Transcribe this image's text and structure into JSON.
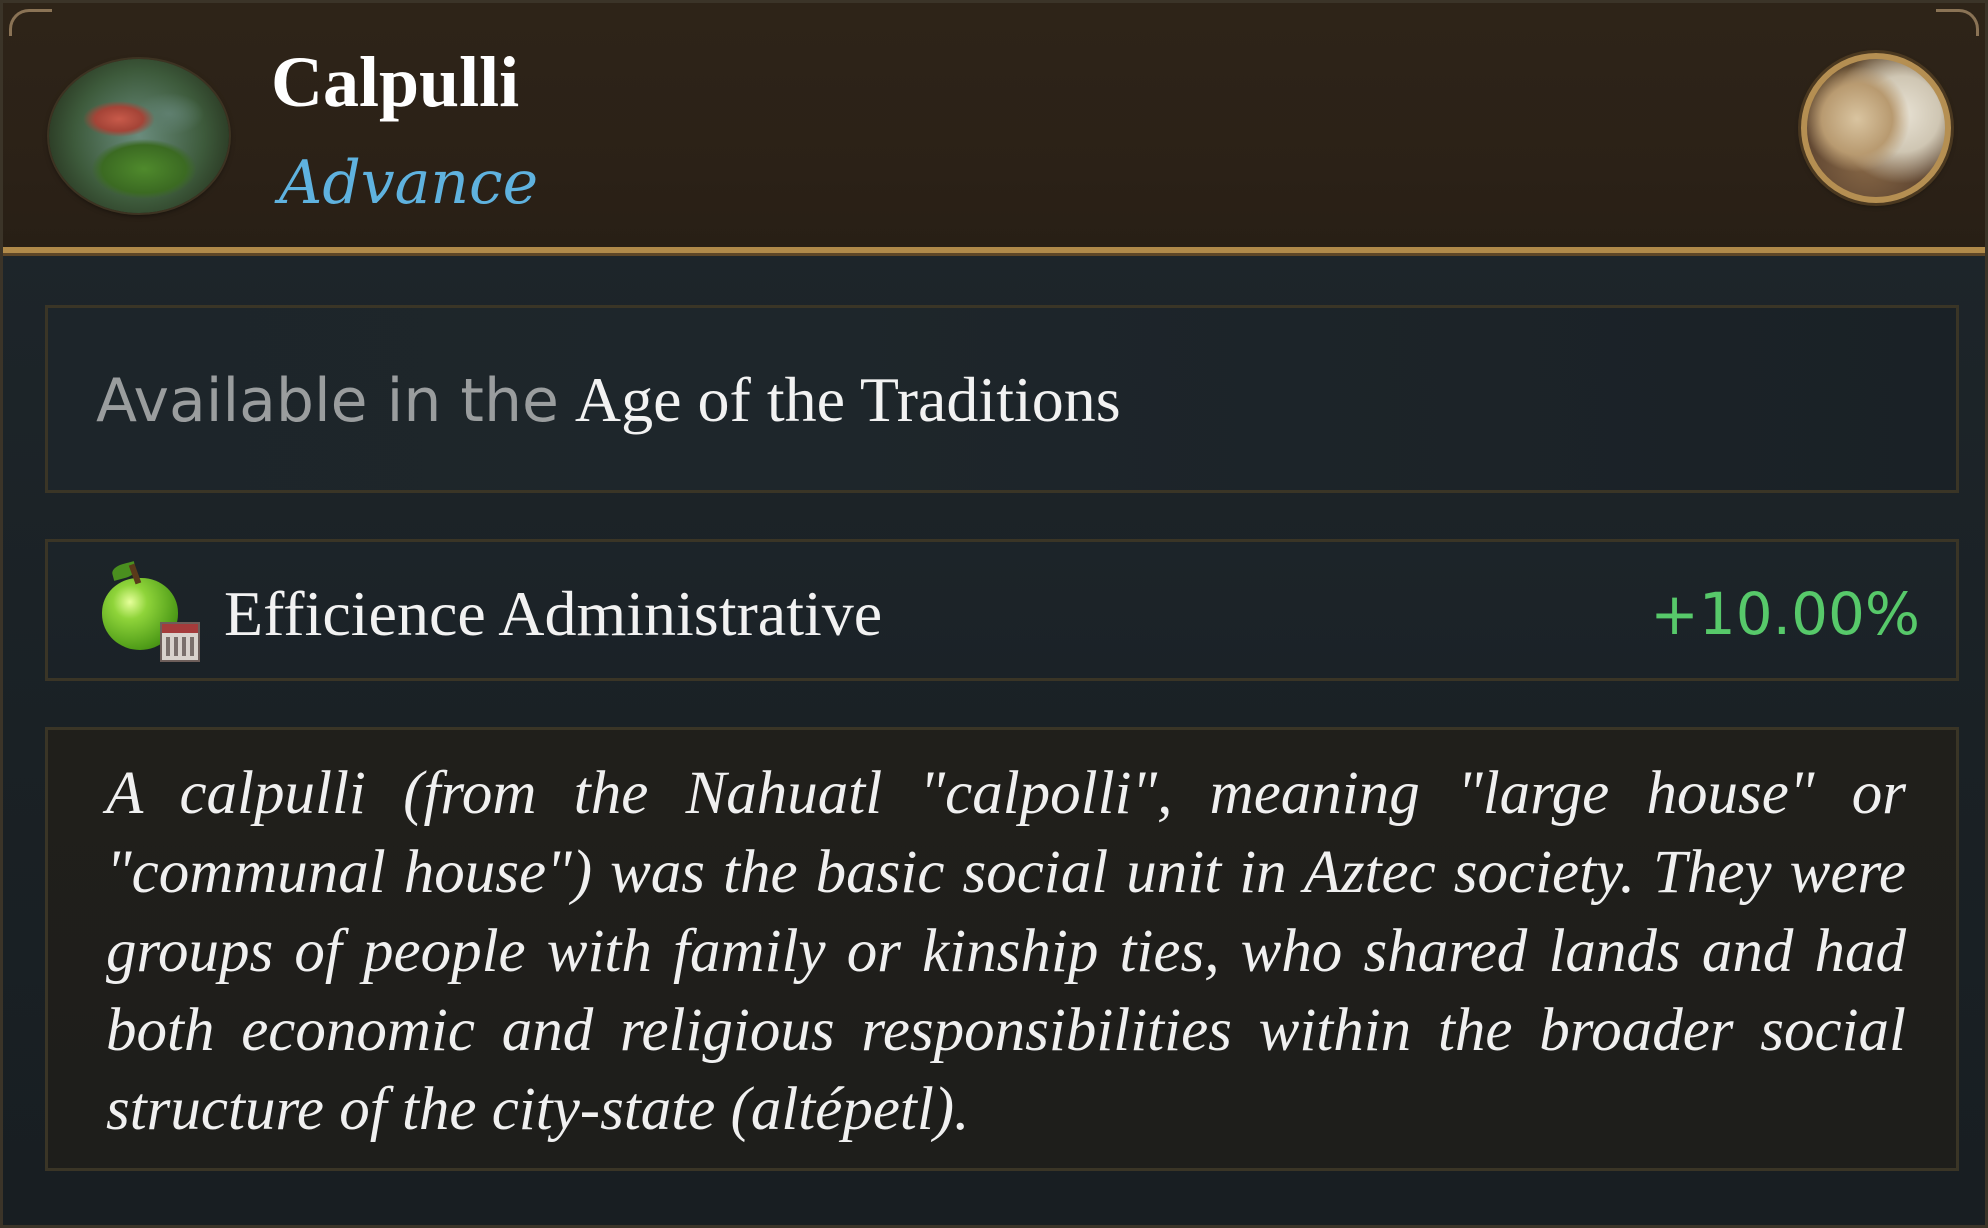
{
  "header": {
    "title": "Calpulli",
    "subtitle": "Advance",
    "advance_icon": "calpulli-garden-image",
    "leader_icon": "leader-portrait"
  },
  "availability": {
    "prefix": "Available in the",
    "age": "Age of the Traditions"
  },
  "effect": {
    "icon": "apple-calendar-icon",
    "label": "Efficience Administrative",
    "value": "+10.00%",
    "value_color": "#57c96a"
  },
  "description": "A calpulli (from the Nahuatl \"calpolli\", meaning \"large house\" or \"communal house\") was the basic social unit in Aztec society. They were groups of people with family or kinship ties, who shared lands and had both economic and religious responsibilities within the broader social structure of the city-state (altépetl).",
  "colors": {
    "accent_blue": "#5fb2df",
    "gold_border": "#b08a4a",
    "positive_green": "#57c96a"
  }
}
